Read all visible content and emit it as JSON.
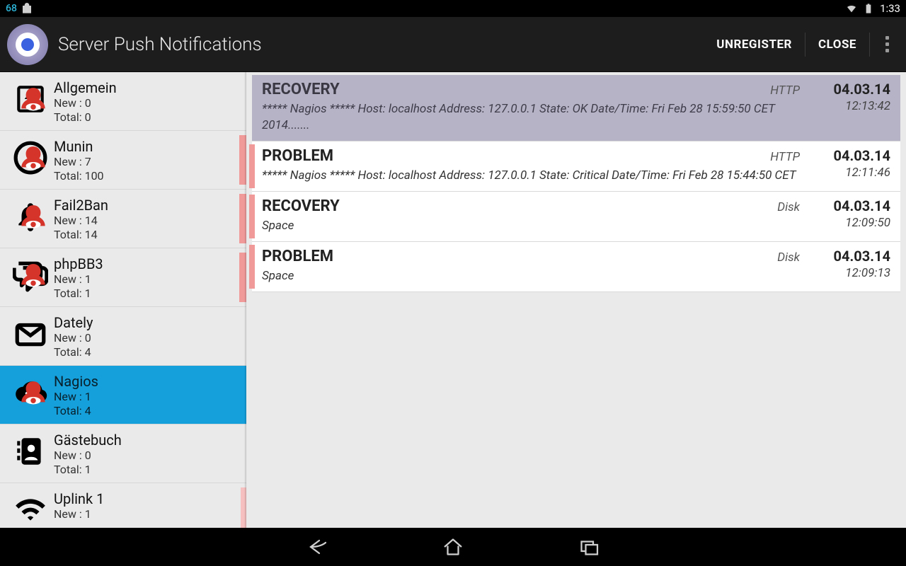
{
  "statusbar": {
    "count": "68",
    "time": "1:33"
  },
  "actionbar": {
    "title": "Server Push Notifications",
    "unregister": "UNREGISTER",
    "close": "CLOSE"
  },
  "sidebar": {
    "items": [
      {
        "name": "Allgemein",
        "new": "New :  0",
        "total": "Total: 0",
        "icon": "download",
        "badge": true
      },
      {
        "name": "Munin",
        "new": "New :  7",
        "total": "Total: 100",
        "icon": "alert",
        "mark": "red",
        "badge": true
      },
      {
        "name": "Fail2Ban",
        "new": "New :  14",
        "total": "Total: 14",
        "icon": "bell",
        "mark": "red",
        "badge": true
      },
      {
        "name": "phpBB3",
        "new": "New :  1",
        "total": "Total: 1",
        "icon": "chat",
        "mark": "red",
        "badge": true
      },
      {
        "name": "Dately",
        "new": "New :  0",
        "total": "Total: 4",
        "icon": "mail"
      },
      {
        "name": "Nagios",
        "new": "New :  1",
        "total": "Total: 4",
        "icon": "cloud",
        "selected": true,
        "badge": true
      },
      {
        "name": "Gästebuch",
        "new": "New :  0",
        "total": "Total: 1",
        "icon": "contact"
      },
      {
        "name": "Uplink 1",
        "new": "New :  1",
        "total": "",
        "icon": "wifi",
        "mark": "pink"
      }
    ]
  },
  "notifications": [
    {
      "title": "RECOVERY",
      "tag": "HTTP",
      "body": "***** Nagios ***** Host: localhost Address: 127.0.0.1 State: OK  Date/Time: Fri Feb 28  15:59:50 CET 2014.......",
      "date": "04.03.14",
      "time": "12:13:42",
      "selected": true
    },
    {
      "title": "PROBLEM",
      "tag": "HTTP",
      "body": "***** Nagios ***** Host: localhost Address: 127.0.0.1 State: Critical  Date/Time: Fri Feb 28 15:44:50 CET",
      "date": "04.03.14",
      "time": "12:11:46",
      "mark": true
    },
    {
      "title": "RECOVERY",
      "tag": "Disk",
      "body": "Space",
      "date": "04.03.14",
      "time": "12:09:50",
      "mark": true
    },
    {
      "title": "PROBLEM",
      "tag": "Disk",
      "body": "Space",
      "date": "04.03.14",
      "time": "12:09:13",
      "mark": true
    }
  ]
}
